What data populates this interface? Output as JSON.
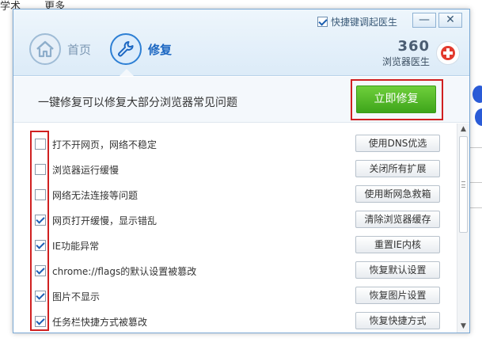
{
  "background": {
    "top_links": [
      "学术",
      "更多"
    ]
  },
  "dialog": {
    "titlebar": {
      "shortcut_check_label": "快捷键调起医生",
      "shortcut_checked": true,
      "minimize_glyph": "—",
      "close_glyph": "✕"
    },
    "nav": {
      "home_label": "首页",
      "repair_label": "修复",
      "active_tab": "修复"
    },
    "brand": {
      "number": "360",
      "name": "浏览器医生"
    },
    "info": {
      "text": "一键修复可以修复大部分浏览器常见问题",
      "fix_button_label": "立即修复"
    },
    "items": [
      {
        "label": "打不开网页，网络不稳定",
        "checked": false,
        "action": "使用DNS优选"
      },
      {
        "label": "浏览器运行缓慢",
        "checked": false,
        "action": "关闭所有扩展"
      },
      {
        "label": "网络无法连接等问题",
        "checked": false,
        "action": "使用断网急救箱"
      },
      {
        "label": "网页打开缓慢，显示错乱",
        "checked": true,
        "action": "清除浏览器缓存"
      },
      {
        "label": "IE功能异常",
        "checked": true,
        "action": "重置IE内核"
      },
      {
        "label": "chrome://flags的默认设置被篡改",
        "checked": true,
        "action": "恢复默认设置"
      },
      {
        "label": "图片不显示",
        "checked": true,
        "action": "恢复图片设置"
      },
      {
        "label": "任务栏快捷方式被篡改",
        "checked": true,
        "action": "恢复快捷方式"
      }
    ],
    "scrollbar": {
      "up_glyph": "▲",
      "down_glyph": "▼"
    }
  },
  "colors": {
    "accent_blue": "#1c67c2",
    "fix_green": "#4caf22",
    "highlight_red": "#d02020"
  }
}
